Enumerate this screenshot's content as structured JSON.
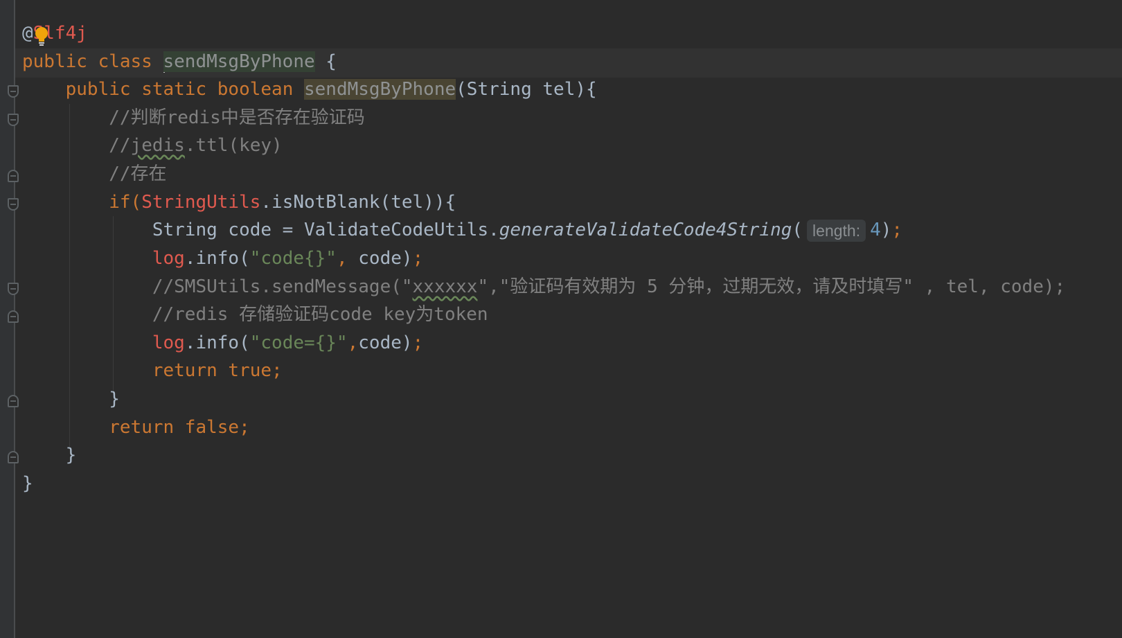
{
  "editor": {
    "annotation_prefix": "@",
    "annotation_name": "Slf4j",
    "class_decl": {
      "kw": "public class ",
      "name": "sendMsgByPhone",
      "tail": " {"
    },
    "method_decl": {
      "kw": "public static boolean ",
      "name": "sendMsgByPhone",
      "params": "(String tel){"
    },
    "comment1": "//判断redis中是否存在验证码",
    "comment2_pre": "//",
    "comment2_word": "jedis",
    "comment2_post": ".ttl(key)",
    "comment3": "//存在",
    "if_kw": "if(",
    "if_class": "StringUtils",
    "if_rest": ".isNotBlank(tel)){",
    "code_line": {
      "pre": "String code = ValidateCodeUtils.",
      "method": "generateValidateCode4String",
      "open": "(",
      "hint": "length:",
      "num": "4",
      "close": ")",
      "semi": ";"
    },
    "log1": {
      "obj": "log",
      "call": ".info(",
      "str": "\"code{}\"",
      "sep": ", ",
      "arg": "code)",
      "semi": ";"
    },
    "sms_comment": {
      "pre": "//SMSUtils.sendMessage(\"",
      "word": "xxxxxx",
      "post": "\",\"验证码有效期为 5 分钟，过期无效，请及时填写\" , tel, code);"
    },
    "redis_comment": "//redis 存储验证码code key为token",
    "log2": {
      "obj": "log",
      "call": ".info(",
      "str": "\"code={}\"",
      "sep": ",",
      "arg": "code)",
      "semi": ";"
    },
    "return_true": "return true;",
    "close_if": "}",
    "return_false": "return false;",
    "close_method": "}",
    "close_class": "}"
  },
  "colors": {
    "background": "#2b2b2b",
    "keyword": "#cc7832",
    "comment": "#808080",
    "string": "#6a8759",
    "number": "#6897bb",
    "field_red": "#e05a4f",
    "text": "#a9b7c6"
  },
  "icons": {
    "intention": "lightbulb-icon"
  }
}
